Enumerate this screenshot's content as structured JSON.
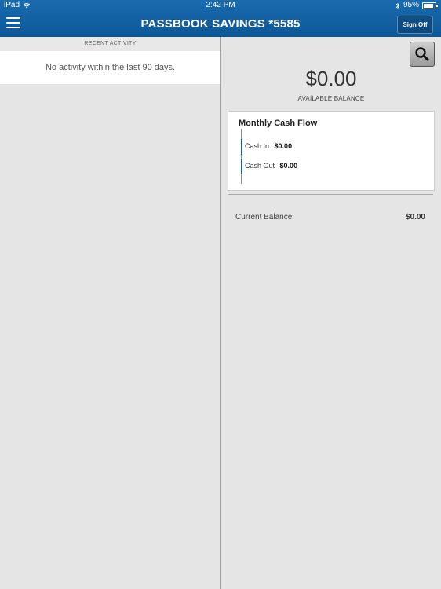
{
  "status_bar": {
    "device": "iPad",
    "time": "2:42 PM",
    "battery": "95%"
  },
  "nav": {
    "title": "PASSBOOK SAVINGS *5585",
    "sign_off_label": "Sign Off",
    "menu_icon": "hamburger-icon"
  },
  "activity": {
    "header": "RECENT ACTIVITY",
    "empty_message": "No activity within the last 90 days."
  },
  "summary": {
    "search_icon": "search-icon",
    "available_balance": "$0.00",
    "available_balance_label": "AVAILABLE BALANCE",
    "cash_flow": {
      "title": "Monthly Cash Flow",
      "cash_in_label": "Cash In",
      "cash_in_value": "$0.00",
      "cash_out_label": "Cash Out",
      "cash_out_value": "$0.00"
    },
    "current_balance_label": "Current Balance",
    "current_balance_value": "$0.00"
  },
  "colors": {
    "header_blue": "#0c5797",
    "bar_blue": "#1a5fa0",
    "background": "#e5e5e5"
  }
}
